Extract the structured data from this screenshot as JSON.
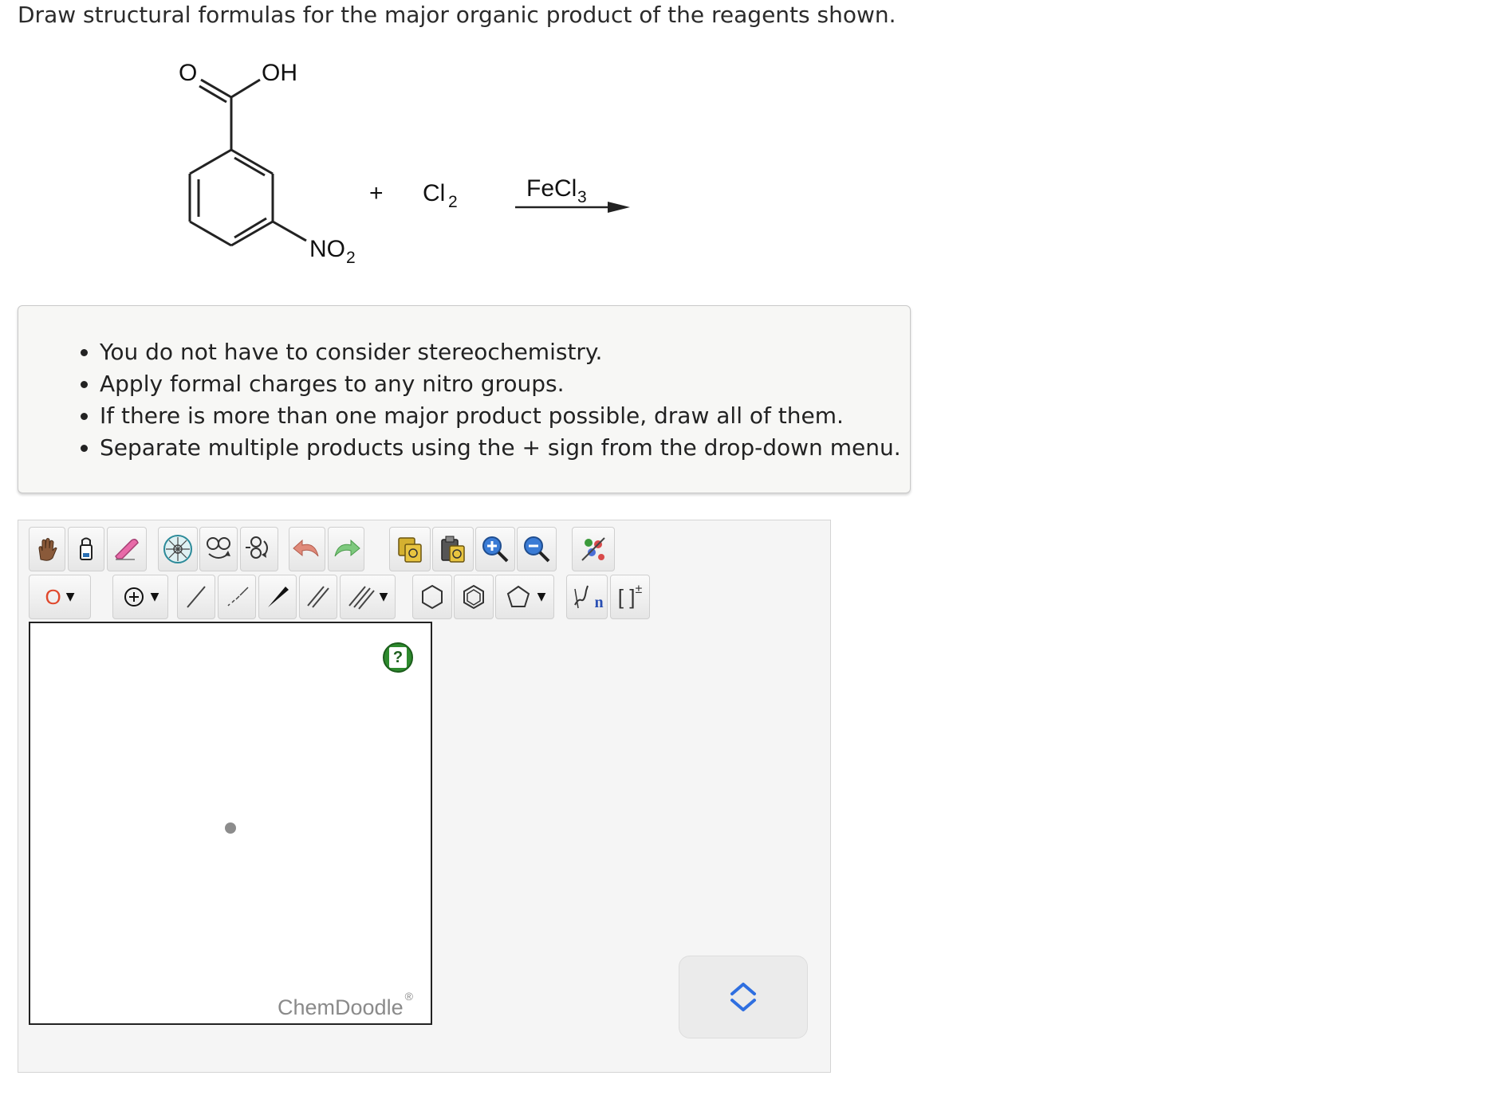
{
  "question": "Draw structural formulas for the major organic product of the reagents shown.",
  "scheme": {
    "reactant_labels": {
      "oxygen": "O",
      "hydroxyl": "OH",
      "nitro": "NO",
      "nitro_sub": "2"
    },
    "plus": "+",
    "reagent": {
      "main": "Cl",
      "sub": "2"
    },
    "catalyst": {
      "main": "FeCl",
      "sub": "3"
    }
  },
  "hints": [
    "You do not have to consider stereochemistry.",
    "Apply formal charges to any nitro groups.",
    "If there is more than one major product possible, draw all of them.",
    "Separate multiple products using the + sign from the drop-down menu."
  ],
  "toolbar": {
    "atom_selected": "O",
    "bracket_label": "[ ]",
    "bracket_sup": "±",
    "sgroup_sub": "n"
  },
  "canvas": {
    "help_label": "?",
    "watermark": "ChemDoodle",
    "watermark_mark": "®"
  }
}
